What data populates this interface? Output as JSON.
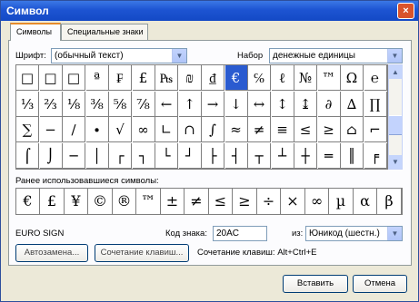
{
  "window": {
    "title": "Символ",
    "close_glyph": "×"
  },
  "tabs": [
    {
      "label": "Символы"
    },
    {
      "label": "Специальные знаки"
    }
  ],
  "font": {
    "label": "Шрифт:",
    "value": "(обычный текст)"
  },
  "subset": {
    "label": "Набор",
    "value": "денежные единицы"
  },
  "grid": {
    "rows": [
      [
        "□",
        "□",
        "□",
        "ª",
        "₣",
        "£",
        "₧",
        "₪",
        "₫",
        "€",
        "℅",
        "ℓ",
        "№",
        "™",
        "Ω",
        "℮"
      ],
      [
        "⅓",
        "⅔",
        "⅛",
        "⅜",
        "⅝",
        "⅞",
        "←",
        "↑",
        "→",
        "↓",
        "↔",
        "↕",
        "↨",
        "∂",
        "∆",
        "∏"
      ],
      [
        "∑",
        "−",
        "∕",
        "∙",
        "√",
        "∞",
        "∟",
        "∩",
        "∫",
        "≈",
        "≠",
        "≡",
        "≤",
        "≥",
        "⌂",
        "⌐"
      ],
      [
        "⌠",
        "⌡",
        "─",
        "│",
        "┌",
        "┐",
        "└",
        "┘",
        "├",
        "┤",
        "┬",
        "┴",
        "┼",
        "═",
        "║",
        "╒"
      ]
    ],
    "selected": {
      "row": 0,
      "col": 9
    }
  },
  "recent": {
    "label": "Ранее использовавшиеся символы:",
    "symbols": [
      "€",
      "£",
      "¥",
      "©",
      "®",
      "™",
      "±",
      "≠",
      "≤",
      "≥",
      "÷",
      "×",
      "∞",
      "µ",
      "α",
      "β"
    ]
  },
  "char_name": "EURO SIGN",
  "code": {
    "label": "Код знака:",
    "value": "20AC",
    "from_label": "из:",
    "from_value": "Юникод (шестн.)"
  },
  "buttons": {
    "autocorrect": "Автозамена...",
    "shortcut_key": "Сочетание клавиш...",
    "insert": "Вставить",
    "cancel": "Отмена"
  },
  "shortcut": "Сочетание клавиш: Alt+Ctrl+E",
  "icons": {
    "dropdown": "▼",
    "scroll_up": "▲",
    "scroll_down": "▼"
  }
}
